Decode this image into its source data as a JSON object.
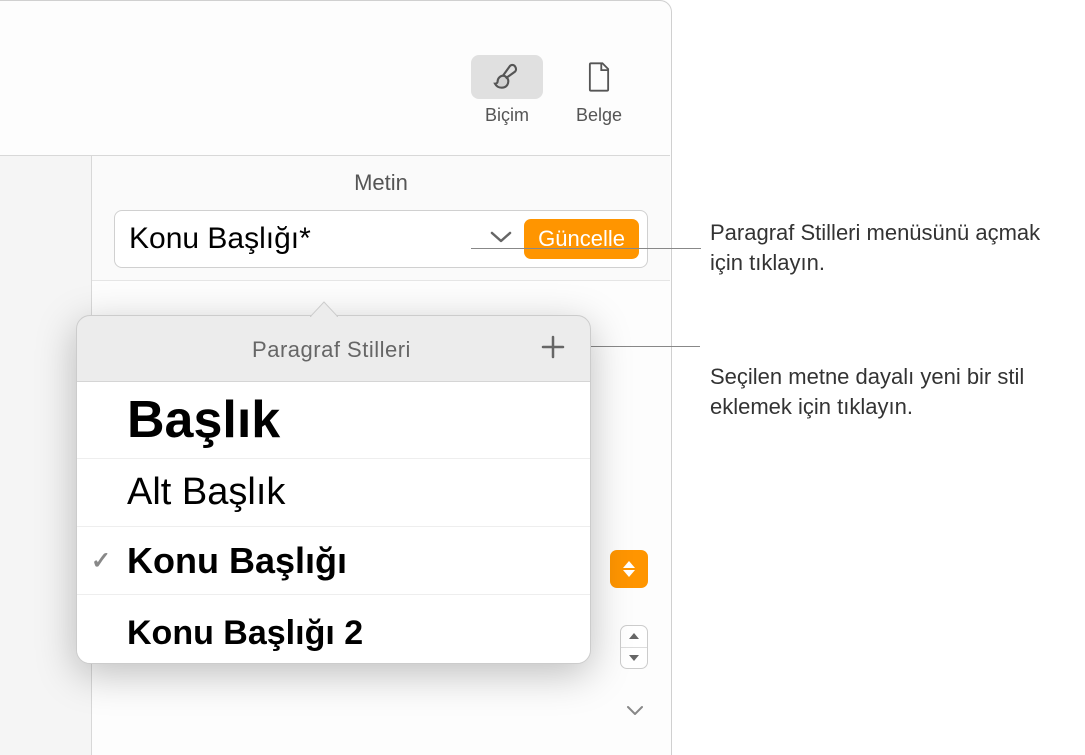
{
  "toolbar": {
    "format": {
      "label": "Biçim"
    },
    "document": {
      "label": "Belge"
    }
  },
  "section_title": "Metin",
  "style_field": {
    "current_style": "Konu Başlığı*",
    "update_label": "Güncelle"
  },
  "popover": {
    "title": "Paragraf Stilleri",
    "styles": [
      {
        "label": "Başlık",
        "selected": false
      },
      {
        "label": "Alt Başlık",
        "selected": false
      },
      {
        "label": "Konu Başlığı",
        "selected": true
      },
      {
        "label": "Konu Başlığı 2",
        "selected": false
      }
    ]
  },
  "callouts": {
    "open_menu": "Paragraf Stilleri menüsünü açmak için tıklayın.",
    "add_style": "Seçilen metne dayalı yeni bir stil eklemek için tıklayın."
  }
}
